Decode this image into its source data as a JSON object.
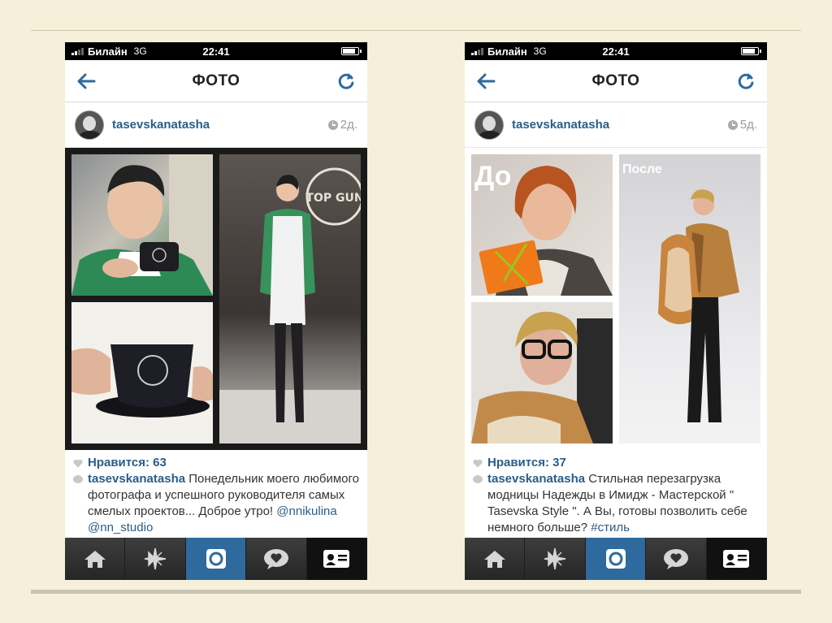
{
  "posts": [
    {
      "status": {
        "carrier": "Билайн",
        "network": "3G",
        "time": "22:41"
      },
      "nav_title": "ФОТО",
      "username": "tasevskanatasha",
      "time_ago": "2д.",
      "likes": "Нравится: 63",
      "comment_author": "tasevskanatasha",
      "comment_text": "Понедельник моего любимого фотографа и успешного руководителя самых смелых проектов... Доброе утро!",
      "comment_tags": "@nnikulina @nn_studio"
    },
    {
      "status": {
        "carrier": "Билайн",
        "network": "3G",
        "time": "22:41"
      },
      "nav_title": "ФОТО",
      "username": "tasevskanatasha",
      "time_ago": "5д.",
      "photo_label_before": "До",
      "photo_label_after": "После",
      "likes": "Нравится: 37",
      "comment_author": "tasevskanatasha",
      "comment_text": "Стильная перезагрузка модницы Надежды в Имидж - Мастерской \" Tasevska Style \". А Вы, готовы позволить себе немного больше?",
      "comment_tags": "#стиль"
    }
  ],
  "tabs": [
    "home",
    "explore",
    "camera",
    "news",
    "profile"
  ],
  "colors": {
    "link": "#2a5d89",
    "tab_active": "#2f6a9f",
    "background": "#f6efd9"
  }
}
